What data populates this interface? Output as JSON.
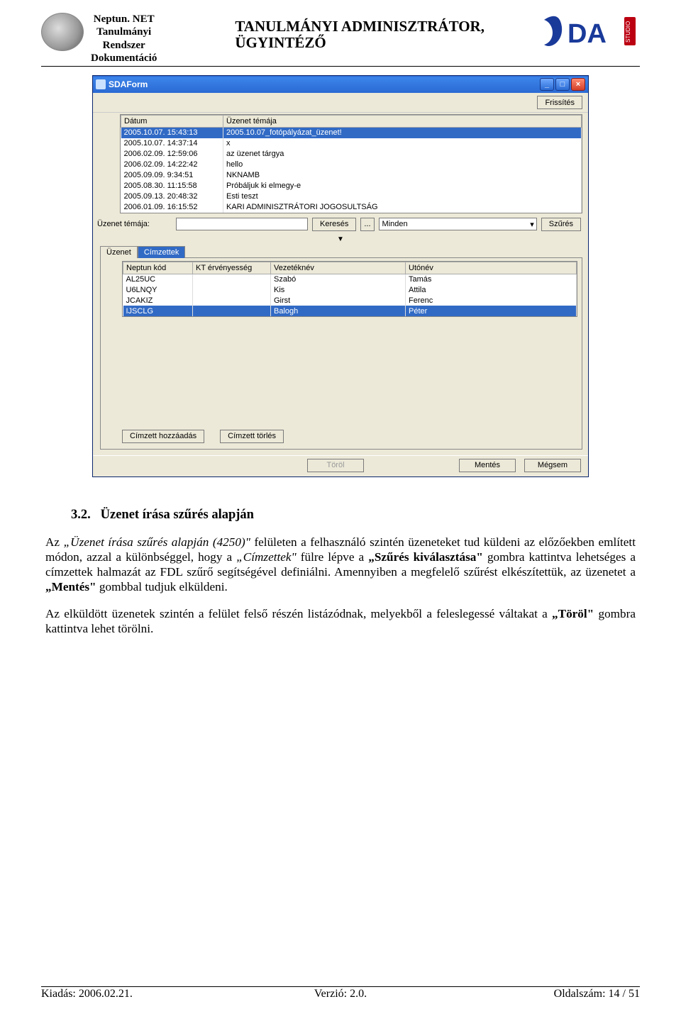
{
  "doc_header": {
    "left_line1": "Neptun. NET",
    "left_line2": "Tanulmányi",
    "left_line3": "Rendszer",
    "left_line4": "Dokumentáció",
    "center_line1": "TANULMÁNYI ADMINISZTRÁTOR,",
    "center_line2": "ÜGYINTÉZŐ"
  },
  "window": {
    "title": "SDAForm",
    "refresh_btn": "Frissítés",
    "grid1": {
      "col_date": "Dátum",
      "col_subject": "Üzenet témája",
      "rows": [
        {
          "date": "2005.10.07. 15:43:13",
          "subject": "2005.10.07_fotópályázat_üzenet!",
          "sel": true
        },
        {
          "date": "2005.10.07. 14:37:14",
          "subject": "x"
        },
        {
          "date": "2006.02.09. 12:59:06",
          "subject": "az üzenet tárgya"
        },
        {
          "date": "2006.02.09. 14:22:42",
          "subject": "hello"
        },
        {
          "date": "2005.09.09. 9:34:51",
          "subject": "NKNAMB"
        },
        {
          "date": "2005.08.30. 11:15:58",
          "subject": "Próbáljuk ki elmegy-e"
        },
        {
          "date": "2005.09.13. 20:48:32",
          "subject": "Esti teszt"
        },
        {
          "date": "2006.01.09. 16:15:52",
          "subject": "KARI ADMINISZTRÁTORI JOGOSULTSÁG"
        }
      ]
    },
    "search": {
      "label": "Üzenet témája:",
      "search_btn": "Keresés",
      "ellipsis_btn": "...",
      "select_value": "Minden",
      "filter_btn": "Szűrés"
    },
    "tab_uzenet": "Üzenet",
    "tab_cimzettek": "Címzettek",
    "grid2": {
      "col_neptun": "Neptun kód",
      "col_kt": "KT érvényesség",
      "col_lastname": "Vezetéknév",
      "col_firstname": "Utónév",
      "rows": [
        {
          "neptun": "AL25UC",
          "kt": "",
          "lastname": "Szabó",
          "firstname": "Tamás"
        },
        {
          "neptun": "U6LNQY",
          "kt": "",
          "lastname": "Kis",
          "firstname": "Attila"
        },
        {
          "neptun": "JCAKIZ",
          "kt": "",
          "lastname": "Girst",
          "firstname": "Ferenc"
        },
        {
          "neptun": "IJSCLG",
          "kt": "",
          "lastname": "Balogh",
          "firstname": "Péter",
          "sel": true
        }
      ]
    },
    "add_recipient_btn": "Címzett hozzáadás",
    "remove_recipient_btn": "Címzett törlés",
    "delete_btn": "Töröl",
    "save_btn": "Mentés",
    "cancel_btn": "Mégsem"
  },
  "content": {
    "section_number": "3.2.",
    "section_title": "Üzenet írása szűrés alapján",
    "p1a": "Az ",
    "p1_italic": "„Üzenet írása szűrés alapján (4250)\"",
    "p1b": " felületen a felhasználó szintén üzeneteket tud küldeni az előzőekben említett módon, azzal a különbséggel, hogy a ",
    "p1_italic2": "„Címzettek\"",
    "p1c": " fülre lépve a ",
    "p1_b1": "„Szűrés kiválasztása\"",
    "p1d": " gombra kattintva lehetséges a címzettek halmazát az FDL szűrő segítségével definiálni. Amennyiben a megfelelő szűrést elkészítettük, az üzenetet a ",
    "p1_b2": "„Mentés\"",
    "p1e": " gombbal tudjuk elküldeni.",
    "p2a": "Az elküldött üzenetek szintén a felület felső részén listázódnak, melyekből a feleslegessé váltakat a ",
    "p2_b1": "„Töröl\"",
    "p2b": " gombra kattintva lehet törölni."
  },
  "footer": {
    "left": "Kiadás: 2006.02.21.",
    "center": "Verzió: 2.0.",
    "right": "Oldalszám: 14 / 51"
  }
}
